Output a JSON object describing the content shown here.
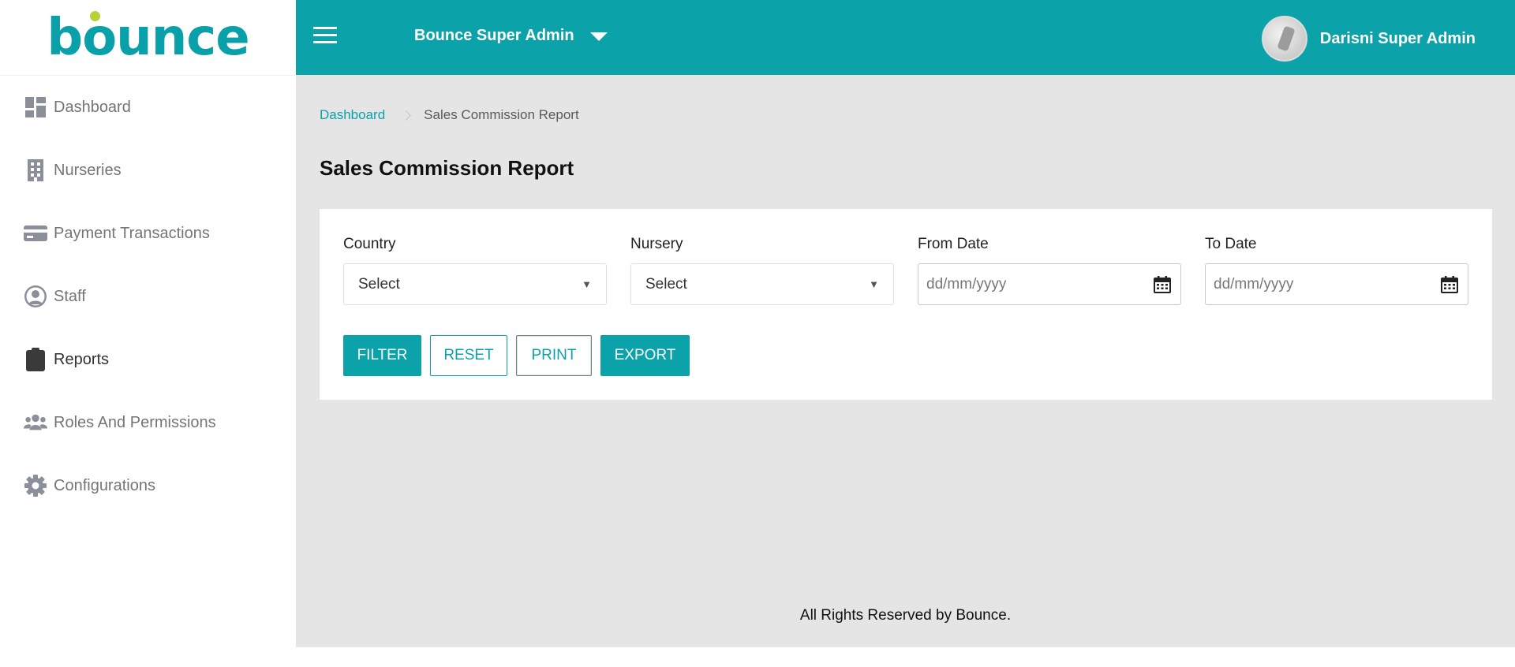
{
  "brand": {
    "logo_text": "bounce"
  },
  "sidebar": {
    "items": [
      {
        "label": "Dashboard",
        "icon": "dashboard-icon"
      },
      {
        "label": "Nurseries",
        "icon": "building-icon"
      },
      {
        "label": "Payment Transactions",
        "icon": "credit-card-icon"
      },
      {
        "label": "Staff",
        "icon": "user-circle-icon"
      },
      {
        "label": "Reports",
        "icon": "clipboard-list-icon",
        "active": true
      },
      {
        "label": "Roles And Permissions",
        "icon": "users-icon"
      },
      {
        "label": "Configurations",
        "icon": "gear-icon"
      }
    ]
  },
  "header": {
    "role_label": "Bounce Super Admin",
    "user_name": "Darisni Super Admin"
  },
  "breadcrumb": {
    "home": "Dashboard",
    "current": "Sales Commission Report"
  },
  "page": {
    "title": "Sales Commission Report"
  },
  "filters": {
    "country": {
      "label": "Country",
      "value": "Select"
    },
    "nursery": {
      "label": "Nursery",
      "value": "Select"
    },
    "from_date": {
      "label": "From Date",
      "placeholder": "dd/mm/yyyy"
    },
    "to_date": {
      "label": "To Date",
      "placeholder": "dd/mm/yyyy"
    }
  },
  "actions": {
    "filter": "FILTER",
    "reset": "RESET",
    "print": "PRINT",
    "export": "EXPORT"
  },
  "footer": {
    "text": "All Rights Reserved by Bounce."
  },
  "colors": {
    "accent": "#0ba2aa",
    "logo_dot": "#b6d336",
    "background": "#e5e5e5"
  }
}
